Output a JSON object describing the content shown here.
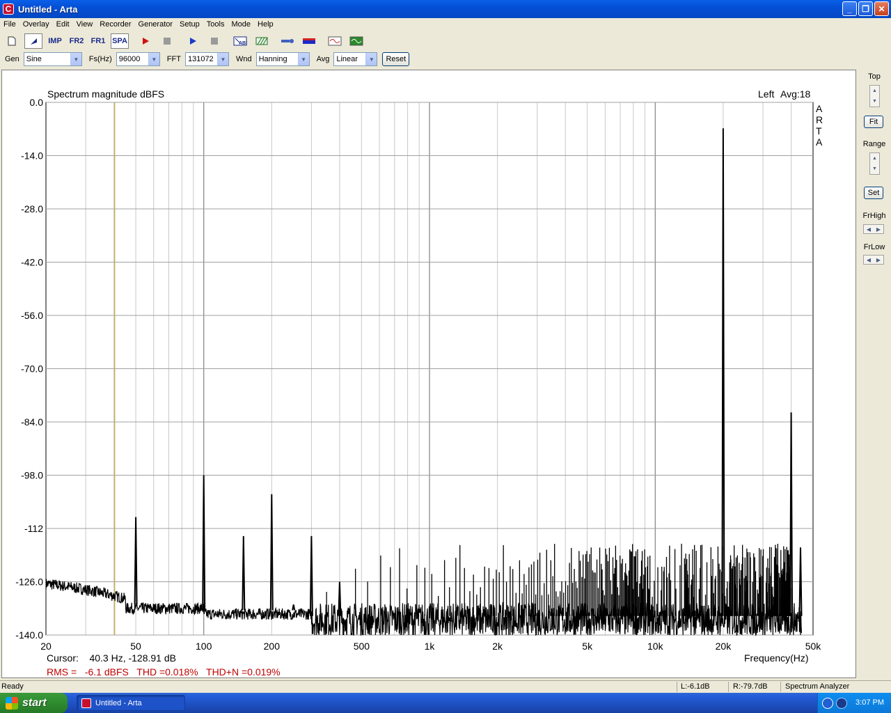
{
  "window": {
    "title": "Untitled - Arta",
    "icon": "arta-icon",
    "buttons": {
      "minimize": "_",
      "maximize": "❐",
      "close": "✕"
    }
  },
  "menu": [
    "File",
    "Overlay",
    "Edit",
    "View",
    "Recorder",
    "Generator",
    "Setup",
    "Tools",
    "Mode",
    "Help"
  ],
  "toolbar": {
    "imp": "IMP",
    "fr2": "FR2",
    "fr1": "FR1",
    "spa": "SPA"
  },
  "options": {
    "gen_label": "Gen",
    "gen_value": "Sine",
    "fs_label": "Fs(Hz)",
    "fs_value": "96000",
    "fft_label": "FFT",
    "fft_value": "131072",
    "wnd_label": "Wnd",
    "wnd_value": "Hanning",
    "avg_label": "Avg",
    "avg_value": "Linear",
    "reset_label": "Reset"
  },
  "right_panel": {
    "top_label": "Top",
    "fit_label": "Fit",
    "range_label": "Range",
    "set_label": "Set",
    "frhigh_label": "FrHigh",
    "frlow_label": "FrLow"
  },
  "chart_data": {
    "type": "line",
    "title": "Spectrum magnitude dBFS",
    "channel_label": "Left",
    "avg_label": "Avg:18",
    "watermark": [
      "A",
      "R",
      "T",
      "A"
    ],
    "xlabel": "Frequency(Hz)",
    "x_scale": "log",
    "xlim": [
      20,
      50000
    ],
    "x_ticks": [
      {
        "value": 20,
        "label": "20"
      },
      {
        "value": 50,
        "label": "50"
      },
      {
        "value": 100,
        "label": "100"
      },
      {
        "value": 200,
        "label": "200"
      },
      {
        "value": 500,
        "label": "500"
      },
      {
        "value": 1000,
        "label": "1k"
      },
      {
        "value": 2000,
        "label": "2k"
      },
      {
        "value": 5000,
        "label": "5k"
      },
      {
        "value": 10000,
        "label": "10k"
      },
      {
        "value": 20000,
        "label": "20k"
      },
      {
        "value": 50000,
        "label": "50k"
      }
    ],
    "ylim": [
      -140,
      0
    ],
    "y_ticks": [
      "0.0",
      "-14.0",
      "-28.0",
      "-42.0",
      "-56.0",
      "-70.0",
      "-84.0",
      "-98.0",
      "-112",
      "-126.0",
      "-140.0"
    ],
    "grid": true,
    "cursor_freq": 40.3,
    "peaks": [
      {
        "freq": 50,
        "db": -109
      },
      {
        "freq": 100,
        "db": -98
      },
      {
        "freq": 150,
        "db": -114
      },
      {
        "freq": 200,
        "db": -103
      },
      {
        "freq": 250,
        "db": -132
      },
      {
        "freq": 300,
        "db": -114
      },
      {
        "freq": 400,
        "db": -126
      },
      {
        "freq": 20000,
        "db": -6.8
      },
      {
        "freq": 40000,
        "db": -81.5
      },
      {
        "freq": 44000,
        "db": -117
      }
    ],
    "noise_floor_db": -136
  },
  "readouts": {
    "cursor": "Cursor:    40.3 Hz, -128.91 dB",
    "measure": "RMS =   -6.1 dBFS   THD =0.018%   THD+N =0.019%"
  },
  "status": {
    "ready": "Ready",
    "left_level": "L:-6.1dB",
    "right_level": "R:-79.7dB",
    "mode": "Spectrum Analyzer"
  },
  "taskbar": {
    "start": "start",
    "item": "Untitled - Arta",
    "clock": "3:07 PM"
  },
  "colors": {
    "cursor_line": "#c8b45a",
    "measure_text": "#c00000",
    "trace": "#000000"
  }
}
